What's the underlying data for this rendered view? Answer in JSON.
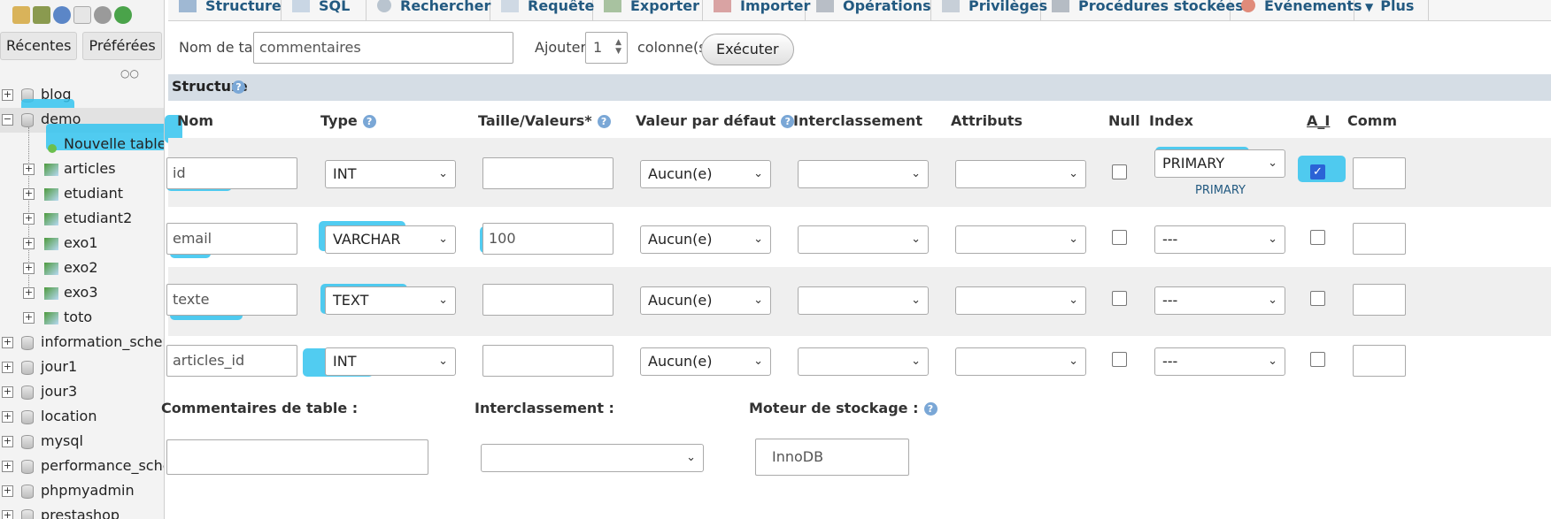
{
  "sidebar": {
    "tabs": [
      "Récentes",
      "Préférées"
    ],
    "databases": [
      {
        "name": "blog",
        "expanded": false
      },
      {
        "name": "demo",
        "expanded": true
      },
      {
        "name": "information_schem",
        "expanded": false
      },
      {
        "name": "jour1",
        "expanded": false
      },
      {
        "name": "jour3",
        "expanded": false
      },
      {
        "name": "location",
        "expanded": false
      },
      {
        "name": "mysql",
        "expanded": false
      },
      {
        "name": "performance_schem",
        "expanded": false
      },
      {
        "name": "phpmyadmin",
        "expanded": false
      },
      {
        "name": "prestashop",
        "expanded": false
      }
    ],
    "new_table": "Nouvelle table",
    "tables": [
      "articles",
      "etudiant",
      "etudiant2",
      "exo1",
      "exo2",
      "exo3",
      "toto"
    ]
  },
  "nav": {
    "tabs": [
      "Structure",
      "SQL",
      "Rechercher",
      "Requête",
      "Exporter",
      "Importer",
      "Opérations",
      "Privilèges",
      "Procédures stockées",
      "Événements",
      "Plus"
    ]
  },
  "form": {
    "table_name_label": "Nom de table:",
    "table_name": "commentaires",
    "add_label": "Ajouter",
    "add_count": "1",
    "columns_label": "colonne(s)",
    "execute": "Exécuter",
    "structure_title": "Structure"
  },
  "headers": {
    "name": "Nom",
    "type": "Type",
    "size": "Taille/Valeurs*",
    "default": "Valeur par défaut",
    "collation": "Interclassement",
    "attributes": "Attributs",
    "null": "Null",
    "index": "Index",
    "ai": "A_I",
    "comments": "Comm"
  },
  "rows": [
    {
      "name": "id",
      "type": "INT",
      "size": "",
      "default": "Aucun(e)",
      "collation": "",
      "attributes": "",
      "null": false,
      "index": "PRIMARY",
      "index_note": "PRIMARY",
      "ai": true
    },
    {
      "name": "email",
      "type": "VARCHAR",
      "size": "100",
      "default": "Aucun(e)",
      "collation": "",
      "attributes": "",
      "null": false,
      "index": "---",
      "index_note": "",
      "ai": false
    },
    {
      "name": "texte",
      "type": "TEXT",
      "size": "",
      "default": "Aucun(e)",
      "collation": "",
      "attributes": "",
      "null": false,
      "index": "---",
      "index_note": "",
      "ai": false
    },
    {
      "name": "articles_id",
      "type": "INT",
      "size": "",
      "default": "Aucun(e)",
      "collation": "",
      "attributes": "",
      "null": false,
      "index": "---",
      "index_note": "",
      "ai": false
    }
  ],
  "footer": {
    "comments_label": "Commentaires de table :",
    "collation_label": "Interclassement :",
    "engine_label": "Moteur de stockage :",
    "engine": "InnoDB"
  },
  "colors": {
    "highlight": "#33c3ef",
    "nav_text": "#235a81",
    "header_bg": "#d5dde5"
  }
}
